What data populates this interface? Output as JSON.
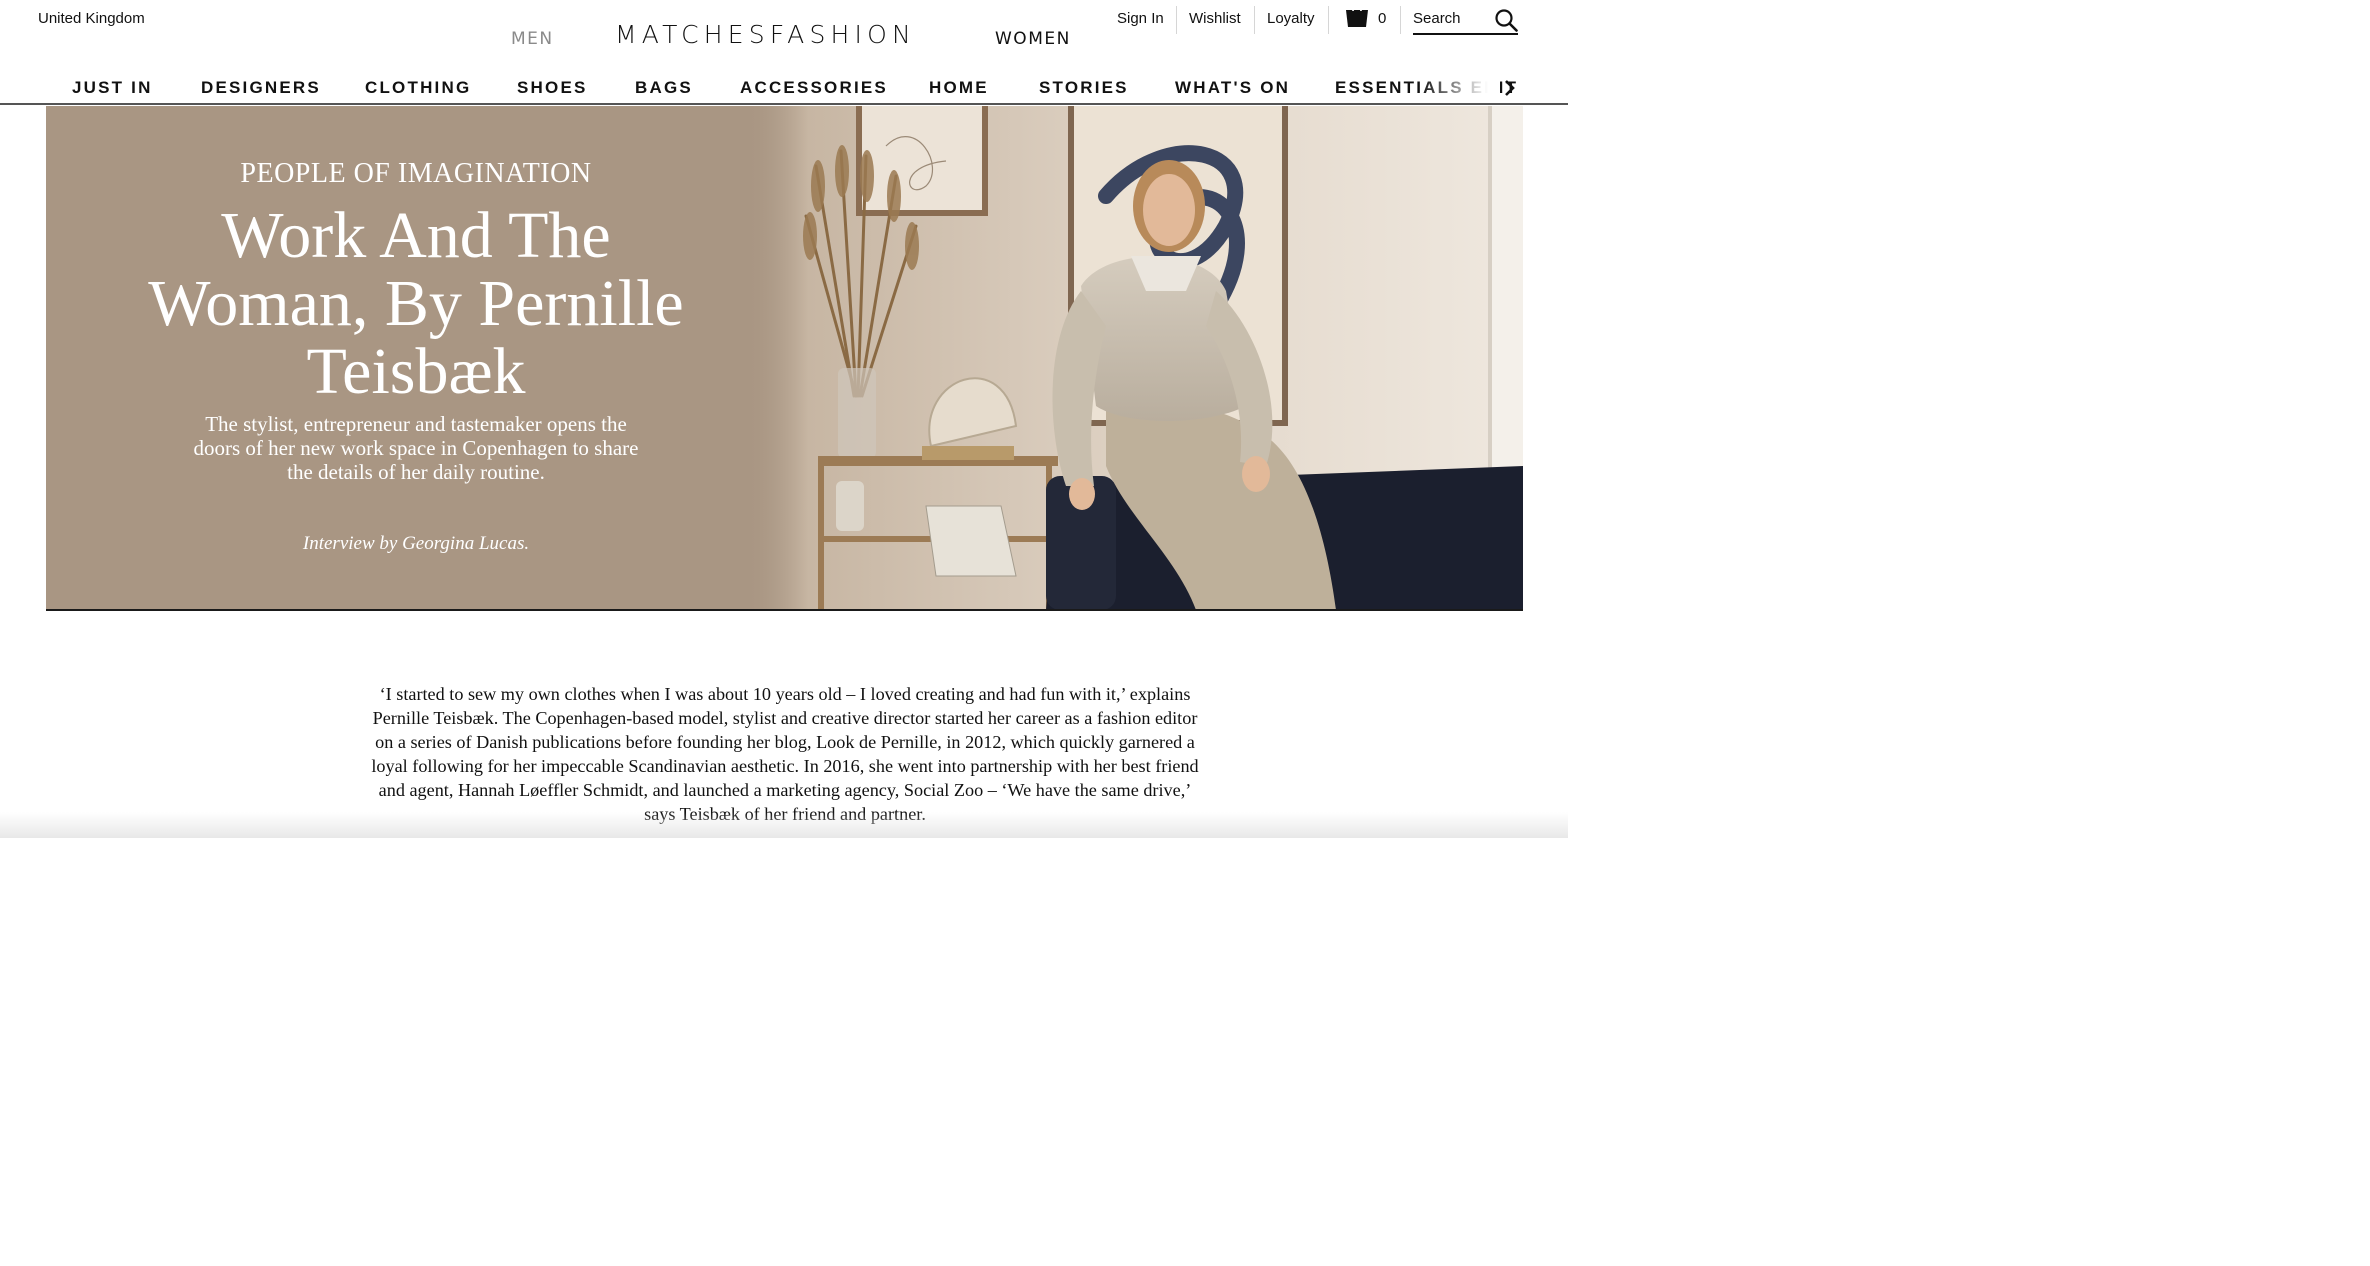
{
  "header": {
    "region": "United Kingdom",
    "men_label": "MEN",
    "women_label": "WOMEN",
    "logo": "MATCHESFASHION",
    "sign_in": "Sign In",
    "wishlist": "Wishlist",
    "loyalty": "Loyalty",
    "bag_count": "0",
    "search_placeholder": "Search",
    "icons": [
      "shopping-bag-icon",
      "search-icon",
      "chevron-right-icon"
    ]
  },
  "nav": {
    "items": [
      "JUST IN",
      "DESIGNERS",
      "CLOTHING",
      "SHOES",
      "BAGS",
      "ACCESSORIES",
      "HOME",
      "STORIES",
      "WHAT'S ON",
      "ESSENTIALS EDIT"
    ]
  },
  "hero": {
    "eyebrow": "PEOPLE OF IMAGINATION",
    "title": "Work And The Woman, By Pernille Teisbæk",
    "subtitle": "The stylist, entrepreneur and tastemaker opens the doors of her new work space in Copenhagen to share the details of her daily routine.",
    "byline": "Interview by Georgina Lucas.",
    "background_color": "#a99683"
  },
  "article": {
    "paragraph": "‘I started to sew my own clothes when I was about 10 years old – I loved creating and had fun with it,’ explains Pernille Teisbæk. The Copenhagen-based model, stylist and creative director started her career as a fashion editor on a series of Danish publications before founding her blog, Look de Pernille, in 2012, which quickly garnered a loyal following for her impeccable Scandinavian aesthetic. In 2016, she went into partnership with her best friend and agent, Hannah Løeffler Schmidt, and launched a marketing agency, Social Zoo – ‘We have the same drive,’ says Teisbæk of her friend and partner."
  }
}
